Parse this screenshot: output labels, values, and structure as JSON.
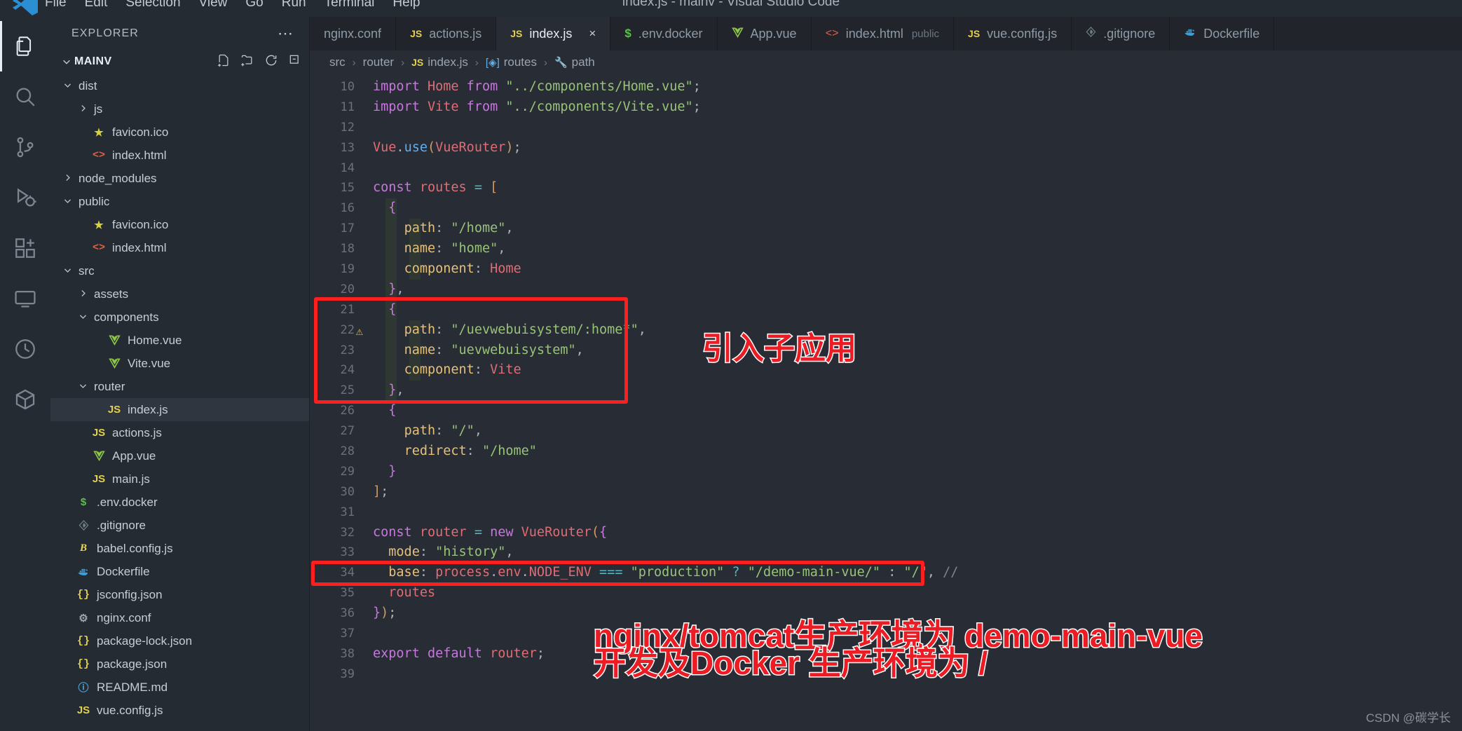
{
  "window": {
    "title": "index.js - mainv - Visual Studio Code"
  },
  "menu": {
    "items": [
      "File",
      "Edit",
      "Selection",
      "View",
      "Go",
      "Run",
      "Terminal",
      "Help"
    ]
  },
  "activitybar": {
    "items": [
      {
        "name": "explorer-icon",
        "label": "Explorer",
        "active": true
      },
      {
        "name": "search-icon",
        "label": "Search",
        "active": false
      },
      {
        "name": "source-control-icon",
        "label": "Source Control",
        "active": false
      },
      {
        "name": "run-debug-icon",
        "label": "Run and Debug",
        "active": false
      },
      {
        "name": "extensions-icon",
        "label": "Extensions",
        "active": false
      },
      {
        "name": "remote-explorer-icon",
        "label": "Remote Explorer",
        "active": false
      },
      {
        "name": "timeline-icon",
        "label": "Timeline",
        "active": false
      },
      {
        "name": "package-icon",
        "label": "Package",
        "active": false
      }
    ]
  },
  "sidebar": {
    "title": "EXPLORER",
    "more_label": "⋯",
    "root": "MAINV",
    "actions": [
      "new-file-icon",
      "new-folder-icon",
      "refresh-icon",
      "collapse-all-icon"
    ],
    "tree": [
      {
        "label": "dist",
        "indent": 1,
        "type": "folder",
        "state": "open",
        "icon": ""
      },
      {
        "label": "js",
        "indent": 2,
        "type": "folder",
        "state": "closed",
        "icon": ""
      },
      {
        "label": "favicon.ico",
        "indent": 2,
        "type": "file",
        "icon": "star"
      },
      {
        "label": "index.html",
        "indent": 2,
        "type": "file",
        "icon": "html"
      },
      {
        "label": "node_modules",
        "indent": 1,
        "type": "folder",
        "state": "closed",
        "icon": ""
      },
      {
        "label": "public",
        "indent": 1,
        "type": "folder",
        "state": "open",
        "icon": ""
      },
      {
        "label": "favicon.ico",
        "indent": 2,
        "type": "file",
        "icon": "star"
      },
      {
        "label": "index.html",
        "indent": 2,
        "type": "file",
        "icon": "html"
      },
      {
        "label": "src",
        "indent": 1,
        "type": "folder",
        "state": "open",
        "icon": ""
      },
      {
        "label": "assets",
        "indent": 2,
        "type": "folder",
        "state": "closed",
        "icon": ""
      },
      {
        "label": "components",
        "indent": 2,
        "type": "folder",
        "state": "open",
        "icon": ""
      },
      {
        "label": "Home.vue",
        "indent": 3,
        "type": "file",
        "icon": "vue"
      },
      {
        "label": "Vite.vue",
        "indent": 3,
        "type": "file",
        "icon": "vue"
      },
      {
        "label": "router",
        "indent": 2,
        "type": "folder",
        "state": "open",
        "icon": ""
      },
      {
        "label": "index.js",
        "indent": 3,
        "type": "file",
        "icon": "js",
        "selected": true
      },
      {
        "label": "actions.js",
        "indent": 2,
        "type": "file",
        "icon": "js"
      },
      {
        "label": "App.vue",
        "indent": 2,
        "type": "file",
        "icon": "vue"
      },
      {
        "label": "main.js",
        "indent": 2,
        "type": "file",
        "icon": "js"
      },
      {
        "label": ".env.docker",
        "indent": 1,
        "type": "file",
        "icon": "env"
      },
      {
        "label": ".gitignore",
        "indent": 1,
        "type": "file",
        "icon": "git"
      },
      {
        "label": "babel.config.js",
        "indent": 1,
        "type": "file",
        "icon": "babel"
      },
      {
        "label": "Dockerfile",
        "indent": 1,
        "type": "file",
        "icon": "docker"
      },
      {
        "label": "jsconfig.json",
        "indent": 1,
        "type": "file",
        "icon": "json"
      },
      {
        "label": "nginx.conf",
        "indent": 1,
        "type": "file",
        "icon": "gear"
      },
      {
        "label": "package-lock.json",
        "indent": 1,
        "type": "file",
        "icon": "json"
      },
      {
        "label": "package.json",
        "indent": 1,
        "type": "file",
        "icon": "json"
      },
      {
        "label": "README.md",
        "indent": 1,
        "type": "file",
        "icon": "info"
      },
      {
        "label": "vue.config.js",
        "indent": 1,
        "type": "file",
        "icon": "js"
      }
    ]
  },
  "tabs": [
    {
      "label": "nginx.conf",
      "icon": "",
      "active": false,
      "suffix": "",
      "closable": false
    },
    {
      "label": "actions.js",
      "icon": "js",
      "active": false,
      "suffix": "",
      "closable": false
    },
    {
      "label": "index.js",
      "icon": "js",
      "active": true,
      "suffix": "",
      "closable": true,
      "close_label": "×"
    },
    {
      "label": ".env.docker",
      "icon": "env",
      "active": false,
      "suffix": "",
      "closable": false
    },
    {
      "label": "App.vue",
      "icon": "vue",
      "active": false,
      "suffix": "",
      "closable": false
    },
    {
      "label": "index.html",
      "icon": "html",
      "active": false,
      "suffix": "public",
      "closable": false
    },
    {
      "label": "vue.config.js",
      "icon": "js",
      "active": false,
      "suffix": "",
      "closable": false
    },
    {
      "label": ".gitignore",
      "icon": "git",
      "active": false,
      "suffix": "",
      "closable": false
    },
    {
      "label": "Dockerfile",
      "icon": "docker",
      "active": false,
      "suffix": "",
      "closable": false
    }
  ],
  "breadcrumb": {
    "items": [
      {
        "label": "src",
        "icon": ""
      },
      {
        "label": "router",
        "icon": ""
      },
      {
        "label": "index.js",
        "icon": "js"
      },
      {
        "label": "routes",
        "icon": "cube"
      },
      {
        "label": "path",
        "icon": "wrench"
      }
    ],
    "separator": "›"
  },
  "editor": {
    "first_line": 10,
    "last_line": 39,
    "warning_line": 22,
    "warning_glyph": "⚠",
    "lines": [
      {
        "n": 10,
        "text": "import Home from \"../components/Home.vue\";"
      },
      {
        "n": 11,
        "text": "import Vite from \"../components/Vite.vue\";"
      },
      {
        "n": 12,
        "text": ""
      },
      {
        "n": 13,
        "text": "Vue.use(VueRouter);"
      },
      {
        "n": 14,
        "text": ""
      },
      {
        "n": 15,
        "text": "const routes = ["
      },
      {
        "n": 16,
        "text": "  {"
      },
      {
        "n": 17,
        "text": "    path: \"/home\","
      },
      {
        "n": 18,
        "text": "    name: \"home\","
      },
      {
        "n": 19,
        "text": "    component: Home"
      },
      {
        "n": 20,
        "text": "  },"
      },
      {
        "n": 21,
        "text": "  {"
      },
      {
        "n": 22,
        "text": "    path: \"/uevwebuisystem/:home*\","
      },
      {
        "n": 23,
        "text": "    name: \"uevwebuisystem\","
      },
      {
        "n": 24,
        "text": "    component: Vite"
      },
      {
        "n": 25,
        "text": "  },"
      },
      {
        "n": 26,
        "text": "  {"
      },
      {
        "n": 27,
        "text": "    path: \"/\","
      },
      {
        "n": 28,
        "text": "    redirect: \"/home\""
      },
      {
        "n": 29,
        "text": "  }"
      },
      {
        "n": 30,
        "text": "];"
      },
      {
        "n": 31,
        "text": ""
      },
      {
        "n": 32,
        "text": "const router = new VueRouter({"
      },
      {
        "n": 33,
        "text": "  mode: \"history\","
      },
      {
        "n": 34,
        "text": "  base: process.env.NODE_ENV === \"production\" ? \"/demo-main-vue/\" : \"/\", //"
      },
      {
        "n": 35,
        "text": "  routes"
      },
      {
        "n": 36,
        "text": "});"
      },
      {
        "n": 37,
        "text": ""
      },
      {
        "n": 38,
        "text": "export default router;"
      },
      {
        "n": 39,
        "text": ""
      }
    ]
  },
  "annotations": {
    "color": "#ec1c24",
    "box_route": {
      "label": "highlight-route-block"
    },
    "box_base": {
      "label": "highlight-base-line"
    },
    "text_route": "引入子应用",
    "text_prod_line1": "nginx/tomcat生产环境为 demo-main-vue",
    "text_prod_line2": "开发及Docker 生产环境为 /"
  },
  "watermark": "CSDN @碳学长"
}
